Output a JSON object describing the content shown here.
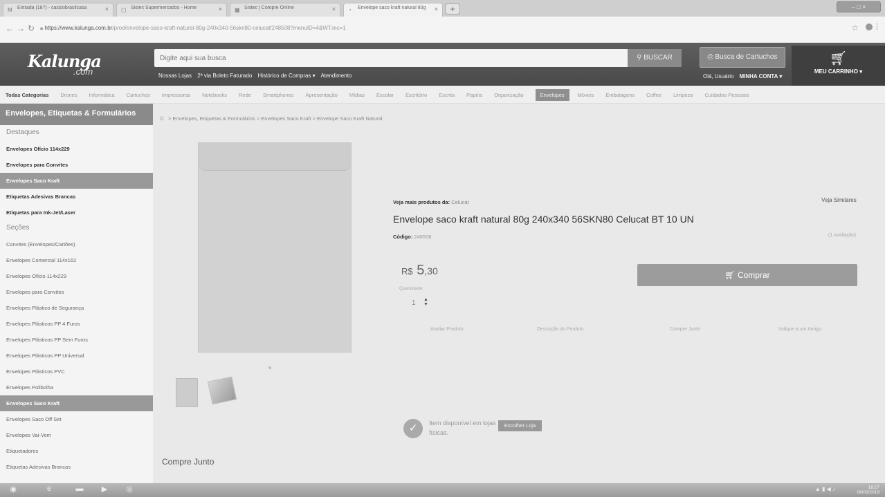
{
  "browser": {
    "tabs": [
      {
        "label": "Entrada (187) - cassiobrasilcasa"
      },
      {
        "label": "Sistec Supermercados - Home"
      },
      {
        "label": "Sistec | Compre Online"
      },
      {
        "label": "Envelope saco kraft natural 80g"
      }
    ],
    "url_domain": "https://www.kalunga.com.br",
    "url_path": "/prod/envelope-saco-kraft-natural-80g-240x340-56skn80-celucat/248508?menuID=4&WT.mc=1",
    "window_controls": "– □ ×"
  },
  "header": {
    "logo": "Kalunga",
    "logo_suffix": ".com",
    "search_placeholder": "Digite aqui sua busca",
    "search_button": "BUSCAR",
    "cartridge_search": "Busca de Cartuchos",
    "links": [
      "Nossas Lojas",
      "2ª via Boleto Faturado",
      "Histórico de Compras ▾",
      "Atendimento"
    ],
    "greeting": "Olá, Usuário",
    "account": "MINHA CONTA ▾",
    "cart": "MEU CARRINHO ▾"
  },
  "categories": [
    "Todas Categorias",
    "Drones",
    "Informática",
    "Cartuchos",
    "Impressoras",
    "Notebooks",
    "Rede",
    "Smartphones",
    "Apresentação",
    "Mídias",
    "Escolar",
    "Escritório",
    "Escrita",
    "Papéis",
    "Organização",
    "Envelopes",
    "Móveis",
    "Embalagens",
    "Coffee",
    "Limpeza",
    "Cuidados Pessoais"
  ],
  "sidebar": {
    "title": "Envelopes, Etiquetas & Formulários",
    "highlights_label": "Destaques",
    "highlights": [
      "Envelopes Ofício 114x229",
      "Envelopes para Convites",
      "Envelopes Saco Kraft",
      "Etiquetas Adesivas Brancas",
      "Etiquetas para Ink-Jet/Laser"
    ],
    "sections_label": "Seções",
    "sections": [
      "Convites (Envelopes/Cartões)",
      "Envelopes Comercial 114x162",
      "Envelopes Ofício 114x229",
      "Envelopes para Convites",
      "Envelopes Plástico de Segurança",
      "Envelopes Plásticos PP 4 Furos",
      "Envelopes Plásticos PP Sem Furos",
      "Envelopes Plásticos PP Universal",
      "Envelopes Plásticos PVC",
      "Envelopes Polibolha",
      "Envelopes Saco Kraft",
      "Envelopes Saco Off Set",
      "Envelopes Vai-Vem",
      "Etiquetadores",
      "Etiquetas Adesivas Brancas"
    ]
  },
  "breadcrumb": "> Envelopes, Etiquetas & Formulários > Envelopes Saco Kraft > Envelope Saco Kraft Natural",
  "product": {
    "more_from_label": "Veja mais produtos da:",
    "brand": "Celucat",
    "similar": "Veja Similares",
    "title": "Envelope saco kraft natural 80g 240x340 56SKN80 Celucat BT 10 UN",
    "code_label": "Código:",
    "code": "248508",
    "rating": "(1 avaliação)",
    "currency": "R$",
    "price_int": "5",
    "price_cents": ",30",
    "qty_label": "Quantidade:",
    "qty": "1",
    "buy_button": "Comprar",
    "tabs": [
      "Avaliar Produto",
      "Descrição do Produto",
      "Compre Junto",
      "Indique a um Amigo"
    ],
    "availability": "Item disponível em lojas físicas.",
    "choose_store": "Escolher Loja"
  },
  "compre_junto": "Compre Junto",
  "taskbar": {
    "time": "16:27",
    "date": "06/03/2019"
  }
}
